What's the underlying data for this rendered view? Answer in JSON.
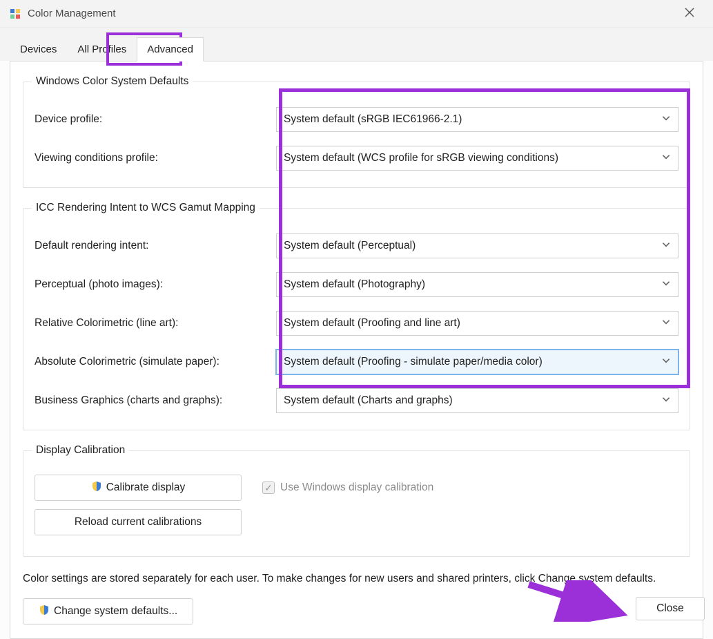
{
  "window": {
    "title": "Color Management"
  },
  "tabs": {
    "devices": "Devices",
    "allProfiles": "All Profiles",
    "advanced": "Advanced"
  },
  "groups": {
    "wcs": {
      "legend": "Windows Color System Defaults",
      "deviceProfile": {
        "label": "Device profile:",
        "value": "System default (sRGB IEC61966-2.1)"
      },
      "viewingConditions": {
        "label": "Viewing conditions profile:",
        "value": "System default (WCS profile for sRGB viewing conditions)"
      }
    },
    "icc": {
      "legend": "ICC Rendering Intent to WCS Gamut Mapping",
      "defaultIntent": {
        "label": "Default rendering intent:",
        "value": "System default (Perceptual)"
      },
      "perceptual": {
        "label": "Perceptual (photo images):",
        "value": "System default (Photography)"
      },
      "relative": {
        "label": "Relative Colorimetric (line art):",
        "value": "System default (Proofing and line art)"
      },
      "absolute": {
        "label": "Absolute Colorimetric (simulate paper):",
        "value": "System default (Proofing - simulate paper/media color)"
      },
      "business": {
        "label": "Business Graphics (charts and graphs):",
        "value": "System default (Charts and graphs)"
      }
    },
    "calibration": {
      "legend": "Display Calibration",
      "calibrateBtn": "Calibrate display",
      "reloadBtn": "Reload current calibrations",
      "useWindowsCalib": "Use Windows display calibration"
    }
  },
  "note": "Color settings are stored separately for each user. To make changes for new users and shared printers, click Change system defaults.",
  "changeDefaultsBtn": "Change system defaults...",
  "closeBtn": "Close",
  "annotations": {
    "highlightColor": "#9b2fd8"
  }
}
